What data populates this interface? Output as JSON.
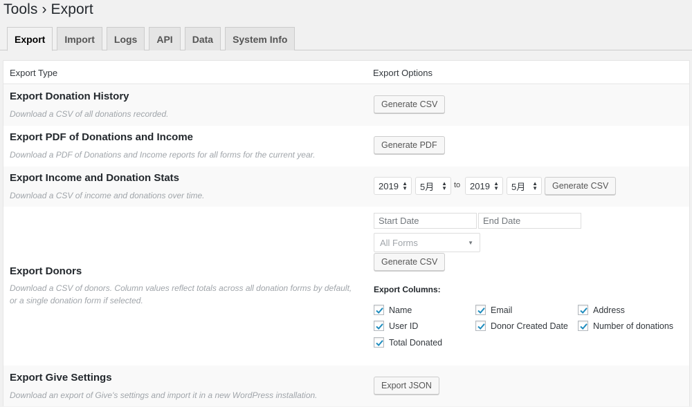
{
  "breadcrumb": {
    "section": "Tools",
    "separator": "›",
    "page": "Export"
  },
  "tabs": [
    {
      "label": "Export",
      "active": true
    },
    {
      "label": "Import",
      "active": false
    },
    {
      "label": "Logs",
      "active": false
    },
    {
      "label": "API",
      "active": false
    },
    {
      "label": "Data",
      "active": false
    },
    {
      "label": "System Info",
      "active": false
    }
  ],
  "table": {
    "col_type": "Export Type",
    "col_options": "Export Options"
  },
  "rows": {
    "history": {
      "title": "Export Donation History",
      "desc": "Download a CSV of all donations recorded.",
      "button": "Generate CSV"
    },
    "pdf": {
      "title": "Export PDF of Donations and Income",
      "desc": "Download a PDF of Donations and Income reports for all forms for the current year.",
      "button": "Generate PDF"
    },
    "stats": {
      "title": "Export Income and Donation Stats",
      "desc": "Download a CSV of income and donations over time.",
      "start_year": "2019",
      "start_month": "5月",
      "to": "to",
      "end_year": "2019",
      "end_month": "5月",
      "button": "Generate CSV"
    },
    "donors": {
      "title": "Export Donors",
      "desc": "Download a CSV of donors. Column values reflect totals across all donation forms by default, or a single donation form if selected.",
      "start_placeholder": "Start Date",
      "end_placeholder": "End Date",
      "forms_select": "All Forms",
      "button": "Generate CSV",
      "columns_label": "Export Columns:",
      "columns": {
        "name": "Name",
        "email": "Email",
        "address": "Address",
        "user_id": "User ID",
        "created": "Donor Created Date",
        "count": "Number of donations",
        "total": "Total Donated"
      }
    },
    "settings": {
      "title": "Export Give Settings",
      "desc": "Download an export of Give's settings and import it in a new WordPress installation.",
      "button": "Export JSON"
    }
  },
  "icons": {
    "checkbox": "checkmark-icon",
    "stepper": "up-down-arrows-icon",
    "dropdown": "caret-down-icon"
  },
  "colors": {
    "check": "#1e8cbe",
    "muted_text": "#a0a5aa"
  }
}
